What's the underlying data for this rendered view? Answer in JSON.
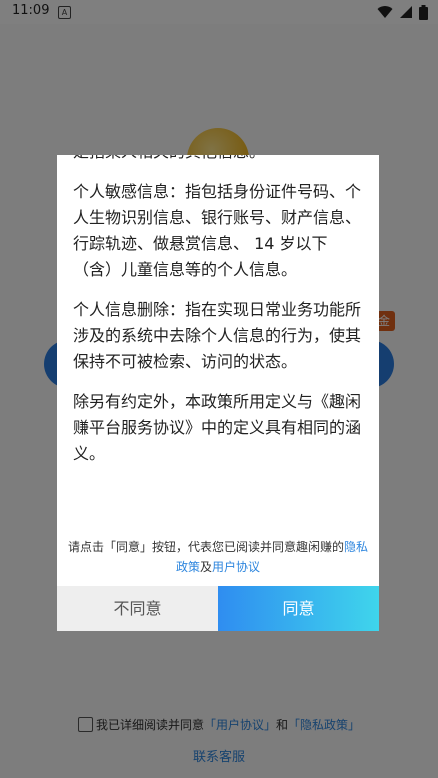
{
  "status_bar": {
    "time": "11:09",
    "notification_letter": "A"
  },
  "background": {
    "badge_text": "金",
    "agree_prefix": "我已详细阅读并同意",
    "user_agreement_link": "「用户协议」",
    "and_text": "和",
    "privacy_link": "「隐私政策」",
    "contact_service": "联系客服"
  },
  "dialog": {
    "paragraphs": [
      "是指某人相关的其他信息。",
      "个人敏感信息：指包括身份证件号码、个人生物识别信息、银行账号、财产信息、行踪轨迹、做悬赏信息、 14 岁以下（含）儿童信息等的个人信息。",
      "个人信息删除：指在实现日常业务功能所涉及的系统中去除个人信息的行为，使其保持不可被检索、访问的状态。",
      "除另有约定外，本政策所用定义与《趣闲赚平台服务协议》中的定义具有相同的涵义。"
    ],
    "notice_prefix": "请点击「同意」按钮，代表您已阅读并同意趣闲赚的",
    "notice_privacy": "隐私政策",
    "notice_and": "及",
    "notice_user": "用户协议",
    "disagree_label": "不同意",
    "agree_label": "同意"
  },
  "colors": {
    "accent": "#2e86de",
    "agree_gradient_start": "#2f8df0",
    "agree_gradient_end": "#3fd5ec"
  }
}
